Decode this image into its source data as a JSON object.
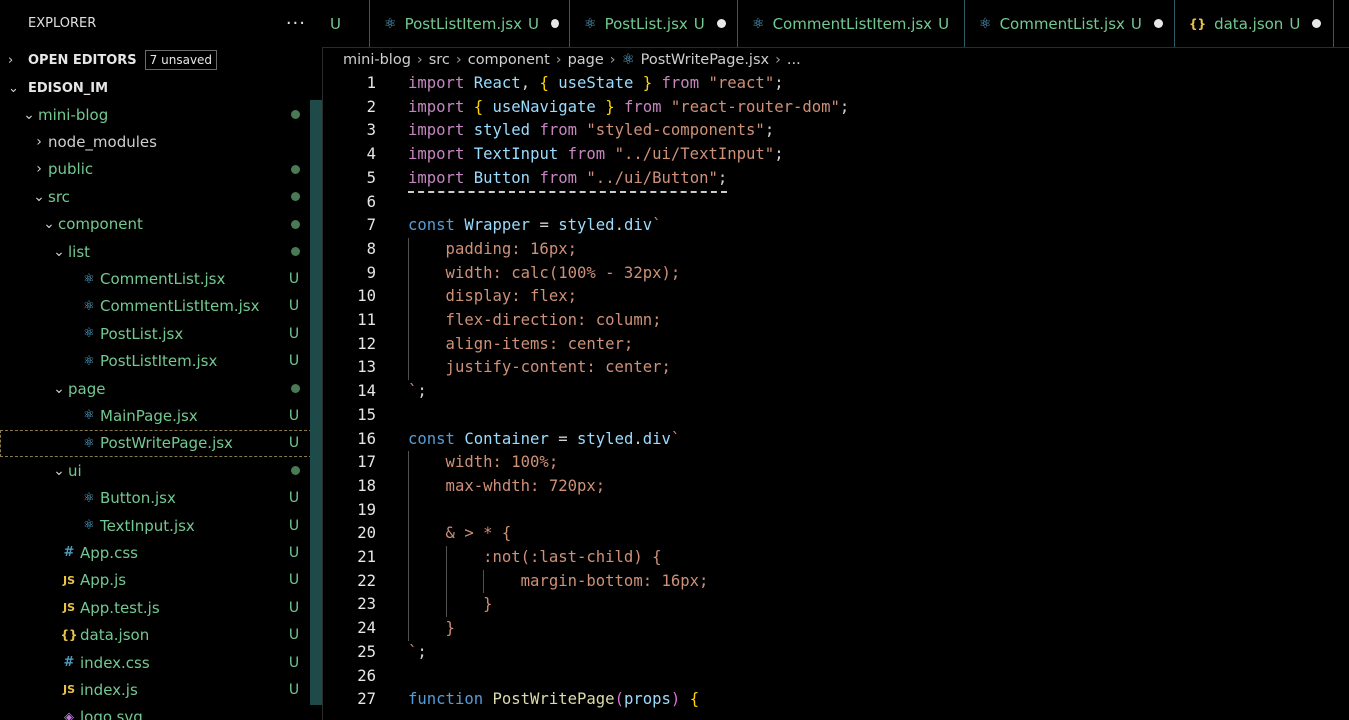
{
  "sidebar": {
    "title": "EXPLORER",
    "more": "···",
    "open_editors": {
      "label": "OPEN EDITORS",
      "badge": "7 unsaved"
    },
    "workspace": "EDISON_IM",
    "tree": [
      {
        "name": "mini-blog",
        "depth": 0,
        "type": "folder",
        "open": true,
        "dot": true
      },
      {
        "name": "node_modules",
        "depth": 1,
        "type": "folder",
        "open": false
      },
      {
        "name": "public",
        "depth": 1,
        "type": "folder",
        "open": false,
        "dot": true
      },
      {
        "name": "src",
        "depth": 1,
        "type": "folder",
        "open": true,
        "dot": true
      },
      {
        "name": "component",
        "depth": 2,
        "type": "folder",
        "open": true,
        "dot": true
      },
      {
        "name": "list",
        "depth": 3,
        "type": "folder",
        "open": true,
        "dot": true
      },
      {
        "name": "CommentList.jsx",
        "depth": 4,
        "type": "react",
        "status": "U"
      },
      {
        "name": "CommentListItem.jsx",
        "depth": 4,
        "type": "react",
        "status": "U"
      },
      {
        "name": "PostList.jsx",
        "depth": 4,
        "type": "react",
        "status": "U"
      },
      {
        "name": "PostListItem.jsx",
        "depth": 4,
        "type": "react",
        "status": "U"
      },
      {
        "name": "page",
        "depth": 3,
        "type": "folder",
        "open": true,
        "dot": true
      },
      {
        "name": "MainPage.jsx",
        "depth": 4,
        "type": "react",
        "status": "U"
      },
      {
        "name": "PostWritePage.jsx",
        "depth": 4,
        "type": "react",
        "status": "U",
        "selected": true
      },
      {
        "name": "ui",
        "depth": 3,
        "type": "folder",
        "open": true,
        "dot": true
      },
      {
        "name": "Button.jsx",
        "depth": 4,
        "type": "react",
        "status": "U"
      },
      {
        "name": "TextInput.jsx",
        "depth": 4,
        "type": "react",
        "status": "U"
      },
      {
        "name": "App.css",
        "depth": 2,
        "type": "css",
        "status": "U"
      },
      {
        "name": "App.js",
        "depth": 2,
        "type": "js",
        "status": "U"
      },
      {
        "name": "App.test.js",
        "depth": 2,
        "type": "js",
        "status": "U"
      },
      {
        "name": "data.json",
        "depth": 2,
        "type": "json",
        "status": "U"
      },
      {
        "name": "index.css",
        "depth": 2,
        "type": "css",
        "status": "U"
      },
      {
        "name": "index.js",
        "depth": 2,
        "type": "js",
        "status": "U"
      },
      {
        "name": "logo.svg",
        "depth": 2,
        "type": "svg",
        "status": ""
      }
    ]
  },
  "tabs": [
    {
      "label": "",
      "status": "U",
      "icon": "none",
      "dirty": false
    },
    {
      "label": "PostListItem.jsx",
      "status": "U",
      "icon": "react",
      "dirty": true
    },
    {
      "label": "PostList.jsx",
      "status": "U",
      "icon": "react",
      "dirty": true
    },
    {
      "label": "CommentListItem.jsx",
      "status": "U",
      "icon": "react",
      "dirty": false
    },
    {
      "label": "CommentList.jsx",
      "status": "U",
      "icon": "react",
      "dirty": true
    },
    {
      "label": "data.json",
      "status": "U",
      "icon": "json",
      "dirty": true
    }
  ],
  "breadcrumb": [
    "mini-blog",
    "src",
    "component",
    "page",
    "PostWritePage.jsx",
    "..."
  ],
  "icons": {
    "react": "⚛",
    "css": "#",
    "js": "JS",
    "json": "{}",
    "svg": "◈",
    "chevron_right": "›",
    "chevron_down": "⌄"
  },
  "colors": {
    "git_untracked": "#73c991",
    "keyword": "#c586c0",
    "string": "#ce9178",
    "variable": "#9cdcfe",
    "storage": "#569cd6"
  },
  "editor": {
    "lines": [
      {
        "n": "1",
        "tokens": [
          [
            "kw",
            "import"
          ],
          [
            "punc",
            " "
          ],
          [
            "id",
            "React"
          ],
          [
            "punc",
            ", "
          ],
          [
            "brace",
            "{"
          ],
          [
            "punc",
            " "
          ],
          [
            "id",
            "useState"
          ],
          [
            "punc",
            " "
          ],
          [
            "brace",
            "}"
          ],
          [
            "punc",
            " "
          ],
          [
            "kw",
            "from"
          ],
          [
            "punc",
            " "
          ],
          [
            "str",
            "\"react\""
          ],
          [
            "punc",
            ";"
          ]
        ]
      },
      {
        "n": "2",
        "tokens": [
          [
            "kw",
            "import"
          ],
          [
            "punc",
            " "
          ],
          [
            "brace",
            "{"
          ],
          [
            "punc",
            " "
          ],
          [
            "id",
            "useNavigate"
          ],
          [
            "punc",
            " "
          ],
          [
            "brace",
            "}"
          ],
          [
            "punc",
            " "
          ],
          [
            "kw",
            "from"
          ],
          [
            "punc",
            " "
          ],
          [
            "str",
            "\"react-router-dom\""
          ],
          [
            "punc",
            ";"
          ]
        ]
      },
      {
        "n": "3",
        "tokens": [
          [
            "kw",
            "import"
          ],
          [
            "punc",
            " "
          ],
          [
            "id",
            "styled"
          ],
          [
            "punc",
            " "
          ],
          [
            "kw",
            "from"
          ],
          [
            "punc",
            " "
          ],
          [
            "str",
            "\"styled-components\""
          ],
          [
            "punc",
            ";"
          ]
        ]
      },
      {
        "n": "4",
        "tokens": [
          [
            "kw",
            "import"
          ],
          [
            "punc",
            " "
          ],
          [
            "id",
            "TextInput"
          ],
          [
            "punc",
            " "
          ],
          [
            "kw",
            "from"
          ],
          [
            "punc",
            " "
          ],
          [
            "str",
            "\"../ui/TextInput\""
          ],
          [
            "punc",
            ";"
          ]
        ]
      },
      {
        "n": "5",
        "tokens": [
          [
            "kw",
            "import"
          ],
          [
            "punc",
            " "
          ],
          [
            "id",
            "Button"
          ],
          [
            "punc",
            " "
          ],
          [
            "kw",
            "from"
          ],
          [
            "punc",
            " "
          ],
          [
            "str",
            "\"../ui/Button\""
          ],
          [
            "punc",
            ";"
          ]
        ],
        "dashed": true
      },
      {
        "n": "6",
        "tokens": []
      },
      {
        "n": "7",
        "tokens": [
          [
            "kw2",
            "const"
          ],
          [
            "punc",
            " "
          ],
          [
            "id",
            "Wrapper"
          ],
          [
            "punc",
            " = "
          ],
          [
            "id",
            "styled"
          ],
          [
            "punc",
            "."
          ],
          [
            "id",
            "div"
          ],
          [
            "str",
            "`"
          ]
        ]
      },
      {
        "n": "8",
        "tokens": [
          [
            "css",
            "    padding: 16px;"
          ]
        ],
        "guides": [
          1
        ]
      },
      {
        "n": "9",
        "tokens": [
          [
            "css",
            "    width: calc(100% - 32px);"
          ]
        ],
        "guides": [
          1
        ]
      },
      {
        "n": "10",
        "tokens": [
          [
            "css",
            "    display: flex;"
          ]
        ],
        "guides": [
          1
        ]
      },
      {
        "n": "11",
        "tokens": [
          [
            "css",
            "    flex-direction: column;"
          ]
        ],
        "guides": [
          1
        ]
      },
      {
        "n": "12",
        "tokens": [
          [
            "css",
            "    align-items: center;"
          ]
        ],
        "guides": [
          1
        ]
      },
      {
        "n": "13",
        "tokens": [
          [
            "css",
            "    justify-content: center;"
          ]
        ],
        "guides": [
          1
        ]
      },
      {
        "n": "14",
        "tokens": [
          [
            "str",
            "`"
          ],
          [
            "punc",
            ";"
          ]
        ]
      },
      {
        "n": "15",
        "tokens": []
      },
      {
        "n": "16",
        "tokens": [
          [
            "kw2",
            "const"
          ],
          [
            "punc",
            " "
          ],
          [
            "id",
            "Container"
          ],
          [
            "punc",
            " = "
          ],
          [
            "id",
            "styled"
          ],
          [
            "punc",
            "."
          ],
          [
            "id",
            "div"
          ],
          [
            "str",
            "`"
          ]
        ]
      },
      {
        "n": "17",
        "tokens": [
          [
            "css",
            "    width: 100%;"
          ]
        ],
        "guides": [
          1
        ]
      },
      {
        "n": "18",
        "tokens": [
          [
            "css",
            "    max-whdth: 720px;"
          ]
        ],
        "guides": [
          1
        ]
      },
      {
        "n": "19",
        "tokens": [],
        "guides": [
          1
        ]
      },
      {
        "n": "20",
        "tokens": [
          [
            "css",
            "    & > * {"
          ]
        ],
        "guides": [
          1
        ]
      },
      {
        "n": "21",
        "tokens": [
          [
            "css",
            "        :not(:last-child) {"
          ]
        ],
        "guides": [
          1,
          2
        ]
      },
      {
        "n": "22",
        "tokens": [
          [
            "css",
            "            margin-bottom: 16px;"
          ]
        ],
        "guides": [
          1,
          2,
          3
        ]
      },
      {
        "n": "23",
        "tokens": [
          [
            "css",
            "        }"
          ]
        ],
        "guides": [
          1,
          2
        ]
      },
      {
        "n": "24",
        "tokens": [
          [
            "css",
            "    }"
          ]
        ],
        "guides": [
          1
        ]
      },
      {
        "n": "25",
        "tokens": [
          [
            "str",
            "`"
          ],
          [
            "punc",
            ";"
          ]
        ]
      },
      {
        "n": "26",
        "tokens": []
      },
      {
        "n": "27",
        "tokens": [
          [
            "kw2",
            "function"
          ],
          [
            "punc",
            " "
          ],
          [
            "fn",
            "PostWritePage"
          ],
          [
            "brace2",
            "("
          ],
          [
            "id",
            "props"
          ],
          [
            "brace2",
            ")"
          ],
          [
            "punc",
            " "
          ],
          [
            "brace",
            "{"
          ]
        ]
      }
    ]
  }
}
